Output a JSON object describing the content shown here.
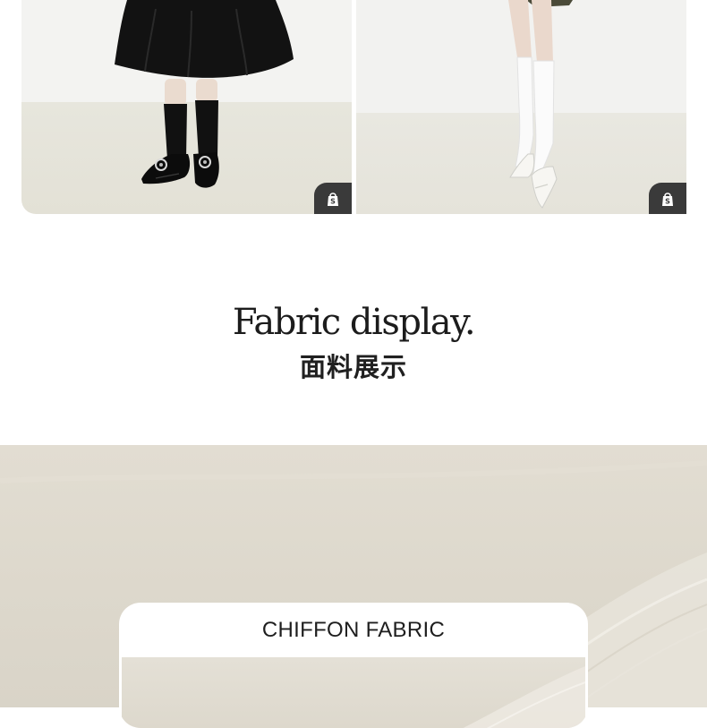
{
  "products": [
    {
      "id": "left",
      "shop_icon": "shopping-bag-icon",
      "shop_glyph": "S"
    },
    {
      "id": "right",
      "shop_icon": "shopping-bag-icon",
      "shop_glyph": "S"
    }
  ],
  "section": {
    "title_en": "Fabric display.",
    "title_cn": "面料展示"
  },
  "fabric": {
    "label": "CHIFFON FABRIC"
  },
  "colors": {
    "shop_button": "#3a3a3a",
    "fabric_background": "#ddd8cc",
    "text": "#1c1c1c"
  }
}
